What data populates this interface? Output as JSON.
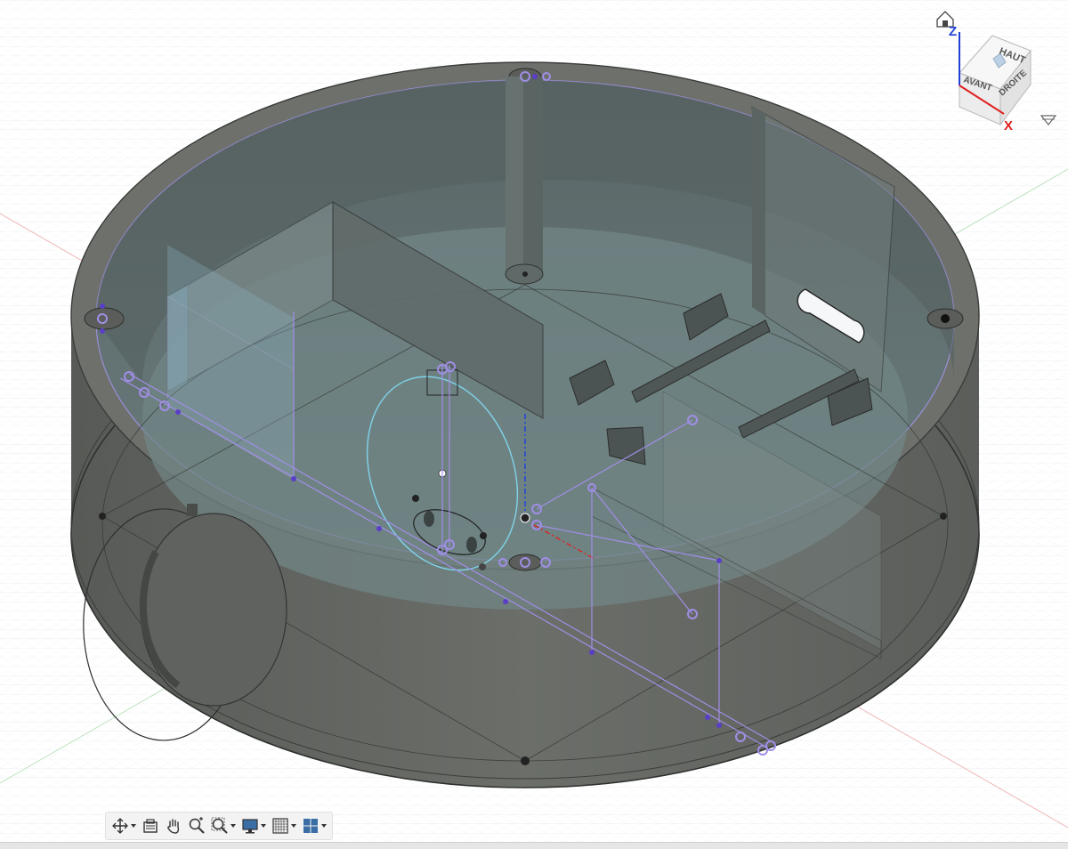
{
  "viewcube": {
    "faces": {
      "top": "HAUT",
      "front": "AVANT",
      "right": "DROITE"
    },
    "axes": {
      "z": "Z",
      "x": "X"
    },
    "colors": {
      "z_axis": "#1f3fd6",
      "x_axis": "#e02020",
      "cube_face": "#f1f1f1",
      "cube_edge": "#b8b8b8"
    }
  },
  "colors": {
    "background": "#ffffff",
    "grid_minor": "#e9ecef",
    "grid_major": "#d3d7dc",
    "body_dark": "#5b5e5a",
    "body_mid": "#6b6e69",
    "interior": "#5e6e6f",
    "floor": "#6f8283",
    "sketch_line": "#a08ee6",
    "sketch_point": "#7a5fd6",
    "selection_cyan": "#7fd3ea"
  },
  "toolbar": {
    "items": [
      {
        "name": "orbit-tool",
        "icon": "orbit-icon",
        "has_menu": true
      },
      {
        "name": "look-at-tool",
        "icon": "look-at-icon",
        "has_menu": false
      },
      {
        "name": "pan-tool",
        "icon": "hand-icon",
        "has_menu": false
      },
      {
        "name": "zoom-tool",
        "icon": "zoom-icon",
        "has_menu": false
      },
      {
        "name": "zoom-window-tool",
        "icon": "zoom-window-icon",
        "has_menu": true
      },
      {
        "name": "display-settings-tool",
        "icon": "monitor-icon",
        "has_menu": true
      },
      {
        "name": "grid-snaps-tool",
        "icon": "grid-icon",
        "has_menu": true
      },
      {
        "name": "viewports-tool",
        "icon": "viewports-icon",
        "has_menu": true
      }
    ]
  }
}
